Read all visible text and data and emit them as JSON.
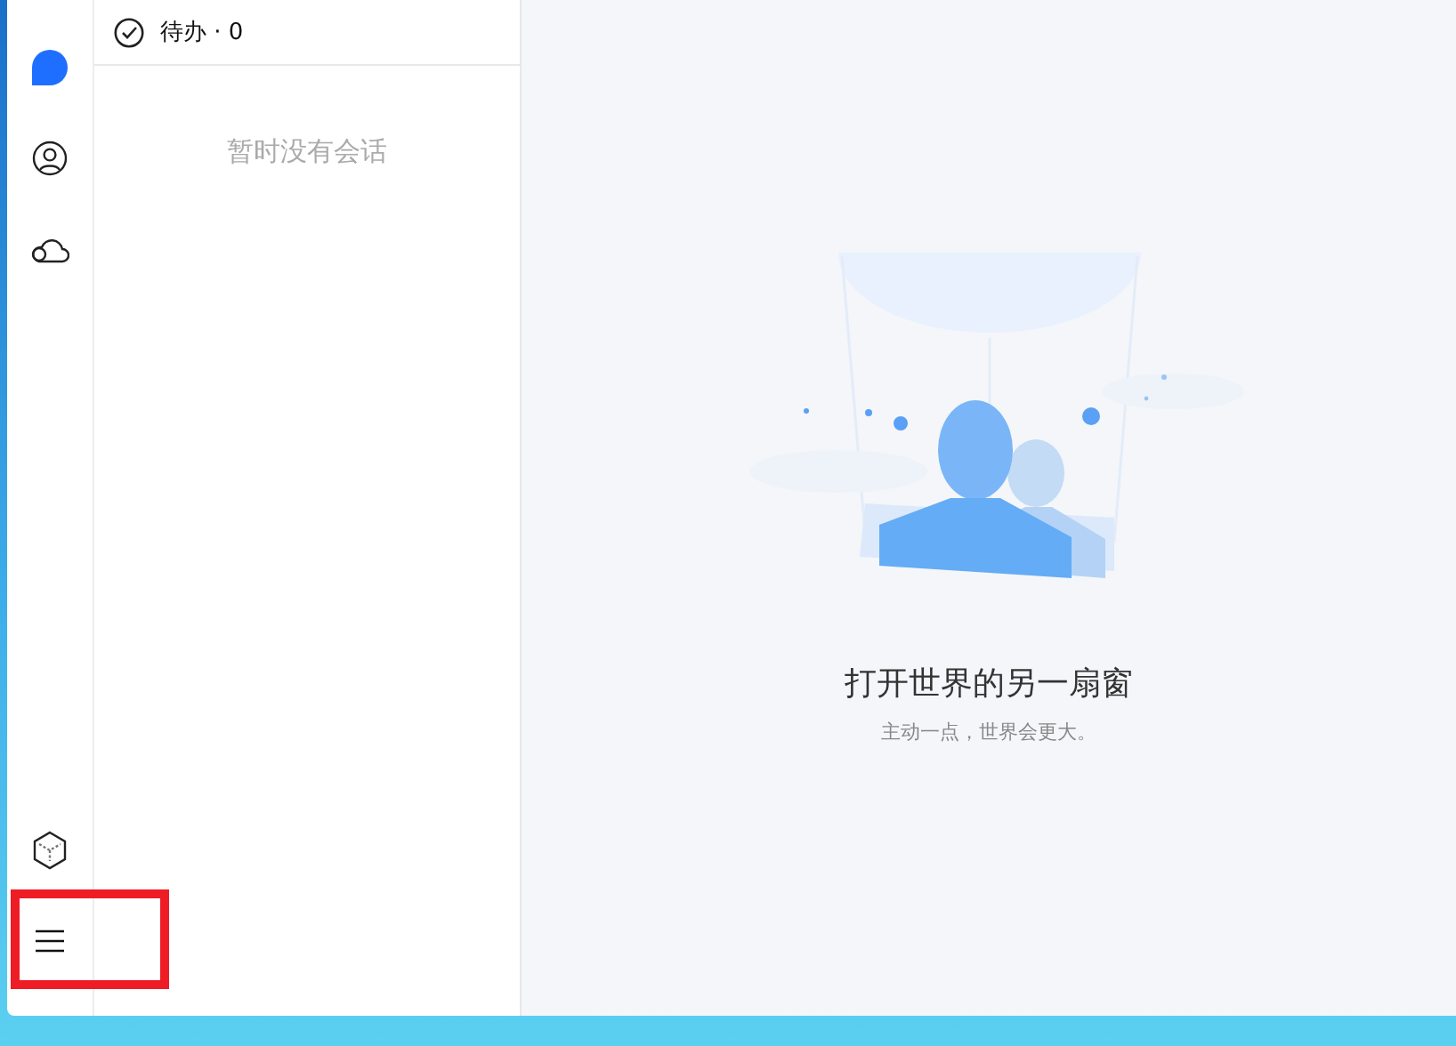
{
  "sidebar": {
    "items": [
      {
        "kind": "chat",
        "selected": true
      },
      {
        "kind": "contacts",
        "selected": false
      },
      {
        "kind": "cloud",
        "selected": false
      }
    ]
  },
  "todo": {
    "label": "待办 · 0"
  },
  "conversations": {
    "empty_text": "暂时没有会话"
  },
  "main": {
    "title": "打开世界的另一扇窗",
    "subtitle": "主动一点，世界会更大。"
  }
}
